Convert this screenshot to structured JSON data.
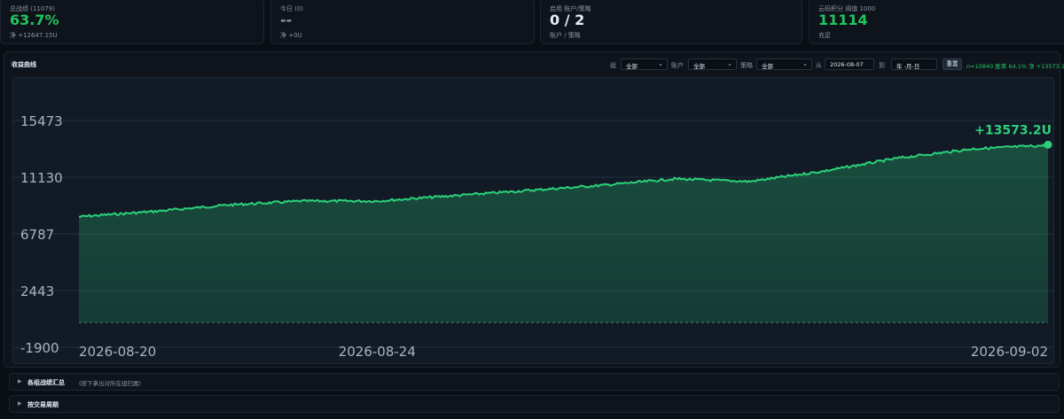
{
  "stats_cards": [
    {
      "label": "总战绩 (11079)",
      "value": "63.7%",
      "sub": "净 +12647.15U"
    },
    {
      "label": "今日 (0)",
      "value": "--",
      "sub": "净 +0U"
    },
    {
      "label": "启用 账户/策略",
      "value": "0 / 2",
      "sub": "账户 / 策略"
    },
    {
      "label": "云码积分 阈值 1000",
      "value": "11114",
      "sub": "充足"
    }
  ],
  "panel": {
    "title": "收益曲线",
    "filters": {
      "group_label": "组",
      "group_value": "全部",
      "account_label": "账户",
      "account_value": "全部",
      "strategy_label": "策略",
      "strategy_value": "全部",
      "from_label": "从",
      "from_value": "2026-08-07",
      "to_label": "到",
      "to_value": "年 -月-日",
      "reset_label": "重置"
    },
    "summary": "n=10840 胜率 64.1% 净 +13573.19U"
  },
  "chart_data": {
    "type": "area",
    "y_ticks": [
      15473,
      11130,
      6787,
      2443,
      -1900
    ],
    "x_ticks": [
      "2026-08-20",
      "2026-08-24",
      "2026-09-02"
    ],
    "ylim": [
      -1900,
      15473
    ],
    "baseline": 0,
    "last_value_label": "+13573.2U",
    "series": [
      {
        "x": [
          "2026-08-20",
          "2026-08-21",
          "2026-08-22",
          "2026-08-23",
          "2026-08-24",
          "2026-08-25",
          "2026-08-26",
          "2026-08-27",
          "2026-08-28",
          "2026-08-29",
          "2026-08-30",
          "2026-08-31",
          "2026-09-01",
          "2026-09-02"
        ],
        "values": [
          8100,
          8500,
          9000,
          9300,
          9300,
          9700,
          10100,
          10500,
          11000,
          10800,
          11600,
          12600,
          13300,
          13573
        ]
      }
    ],
    "color": "#2bd17a"
  },
  "sections": [
    {
      "title": "各组战绩汇总",
      "hint": "(按下拿出对所在组归属)"
    },
    {
      "title": "按交易周期",
      "hint": ""
    }
  ]
}
